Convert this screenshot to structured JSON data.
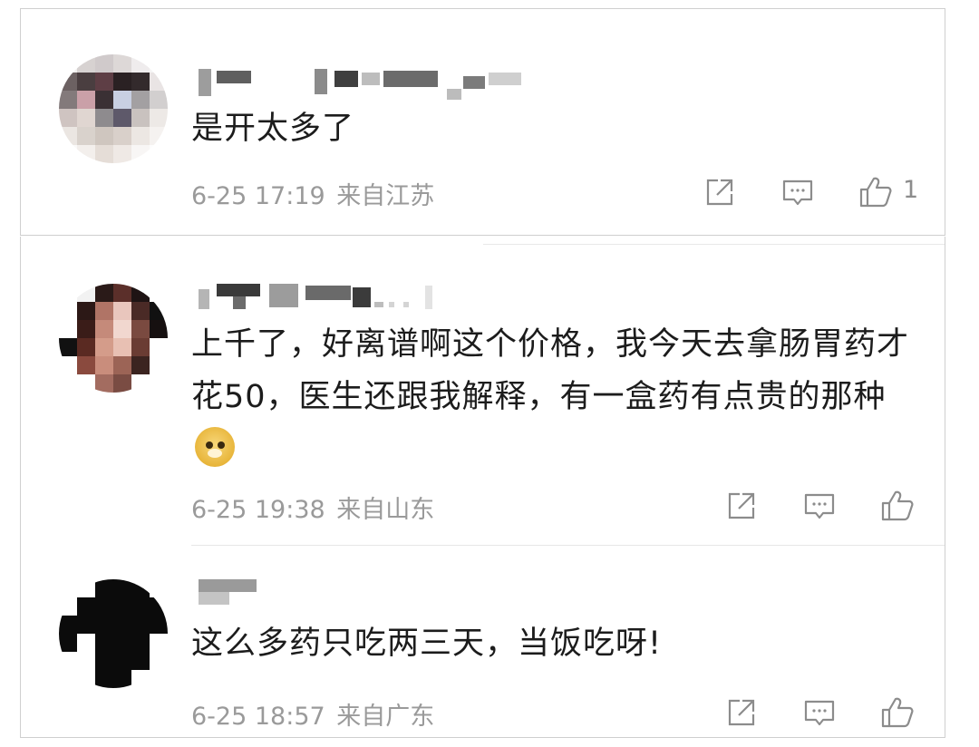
{
  "comments": [
    {
      "text": "是开太多了",
      "time": "6-25 17:19",
      "location": "来自江苏",
      "like_count": "1",
      "icons": [
        "share-icon",
        "comment-icon",
        "like-icon"
      ]
    },
    {
      "text": "上千了，好离谱啊这个价格，我今天去拿肠胃药才花50，医生还跟我解释，有一盒药有点贵的那种",
      "emoji": "doge-emoji-icon",
      "time": "6-25 19:38",
      "location": "来自山东",
      "like_count": "",
      "icons": [
        "share-icon",
        "comment-icon",
        "like-icon"
      ]
    },
    {
      "text": "这么多药只吃两三天，当饭吃呀!",
      "time": "6-25 18:57",
      "location": "来自广东",
      "like_count": "",
      "icons": [
        "share-icon",
        "comment-icon",
        "like-icon"
      ]
    }
  ],
  "colors": {
    "text": "#1c1c1c",
    "meta": "#9a9a9a",
    "icon": "#8c8c8c",
    "divider": "#e6e6e6"
  }
}
